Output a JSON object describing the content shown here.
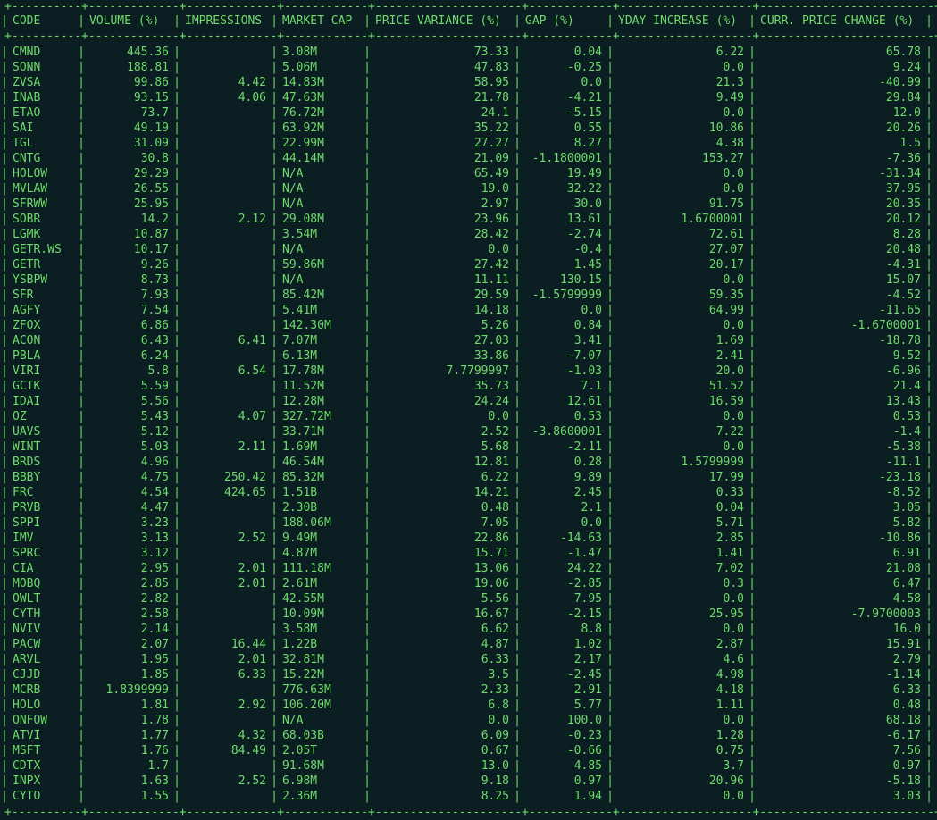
{
  "table": {
    "columns": [
      "CODE",
      "VOLUME (%)",
      "IMPRESSIONS",
      "MARKET CAP",
      "PRICE VARIANCE (%)",
      "GAP (%)",
      "YDAY INCREASE (%)",
      "CURR. PRICE CHANGE (%)"
    ],
    "rows": [
      [
        "CMND",
        "445.36",
        "",
        "3.08M",
        "73.33",
        "0.04",
        "6.22",
        "65.78"
      ],
      [
        "SONN",
        "188.81",
        "",
        "5.06M",
        "47.83",
        "-0.25",
        "0.0",
        "9.24"
      ],
      [
        "ZVSA",
        "99.86",
        "4.42",
        "14.83M",
        "58.95",
        "0.0",
        "21.3",
        "-40.99"
      ],
      [
        "INAB",
        "93.15",
        "4.06",
        "47.63M",
        "21.78",
        "-4.21",
        "9.49",
        "29.84"
      ],
      [
        "ETAO",
        "73.7",
        "",
        "76.72M",
        "24.1",
        "-5.15",
        "0.0",
        "12.0"
      ],
      [
        "SAI",
        "49.19",
        "",
        "63.92M",
        "35.22",
        "0.55",
        "10.86",
        "20.26"
      ],
      [
        "TGL",
        "31.09",
        "",
        "22.99M",
        "27.27",
        "8.27",
        "4.38",
        "1.5"
      ],
      [
        "CNTG",
        "30.8",
        "",
        "44.14M",
        "21.09",
        "-1.1800001",
        "153.27",
        "-7.36"
      ],
      [
        "HOLOW",
        "29.29",
        "",
        "N/A",
        "65.49",
        "19.49",
        "0.0",
        "-31.34"
      ],
      [
        "MVLAW",
        "26.55",
        "",
        "N/A",
        "19.0",
        "32.22",
        "0.0",
        "37.95"
      ],
      [
        "SFRWW",
        "25.95",
        "",
        "N/A",
        "2.97",
        "30.0",
        "91.75",
        "20.35"
      ],
      [
        "SOBR",
        "14.2",
        "2.12",
        "29.08M",
        "23.96",
        "13.61",
        "1.6700001",
        "20.12"
      ],
      [
        "LGMK",
        "10.87",
        "",
        "3.54M",
        "28.42",
        "-2.74",
        "72.61",
        "8.28"
      ],
      [
        "GETR.WS",
        "10.17",
        "",
        "N/A",
        "0.0",
        "-0.4",
        "27.07",
        "20.48"
      ],
      [
        "GETR",
        "9.26",
        "",
        "59.86M",
        "27.42",
        "1.45",
        "20.17",
        "-4.31"
      ],
      [
        "YSBPW",
        "8.73",
        "",
        "N/A",
        "11.11",
        "130.15",
        "0.0",
        "15.07"
      ],
      [
        "SFR",
        "7.93",
        "",
        "85.42M",
        "29.59",
        "-1.5799999",
        "59.35",
        "-4.52"
      ],
      [
        "AGFY",
        "7.54",
        "",
        "5.41M",
        "14.18",
        "0.0",
        "64.99",
        "-11.65"
      ],
      [
        "ZFOX",
        "6.86",
        "",
        "142.30M",
        "5.26",
        "0.84",
        "0.0",
        "-1.6700001"
      ],
      [
        "ACON",
        "6.43",
        "6.41",
        "7.07M",
        "27.03",
        "3.41",
        "1.69",
        "-18.78"
      ],
      [
        "PBLA",
        "6.24",
        "",
        "6.13M",
        "33.86",
        "-7.07",
        "2.41",
        "9.52"
      ],
      [
        "VIRI",
        "5.8",
        "6.54",
        "17.78M",
        "7.7799997",
        "-1.03",
        "20.0",
        "-6.96"
      ],
      [
        "GCTK",
        "5.59",
        "",
        "11.52M",
        "35.73",
        "7.1",
        "51.52",
        "21.4"
      ],
      [
        "IDAI",
        "5.56",
        "",
        "12.28M",
        "24.24",
        "12.61",
        "16.59",
        "13.43"
      ],
      [
        "OZ",
        "5.43",
        "4.07",
        "327.72M",
        "0.0",
        "0.53",
        "0.0",
        "0.53"
      ],
      [
        "UAVS",
        "5.12",
        "",
        "33.71M",
        "2.52",
        "-3.8600001",
        "7.22",
        "-1.4"
      ],
      [
        "WINT",
        "5.03",
        "2.11",
        "1.69M",
        "5.68",
        "-2.11",
        "0.0",
        "-5.38"
      ],
      [
        "BRDS",
        "4.96",
        "",
        "46.54M",
        "12.81",
        "0.28",
        "1.5799999",
        "-11.1"
      ],
      [
        "BBBY",
        "4.75",
        "250.42",
        "85.32M",
        "6.22",
        "9.89",
        "17.99",
        "-23.18"
      ],
      [
        "FRC",
        "4.54",
        "424.65",
        "1.51B",
        "14.21",
        "2.45",
        "0.33",
        "-8.52"
      ],
      [
        "PRVB",
        "4.47",
        "",
        "2.30B",
        "0.48",
        "2.1",
        "0.04",
        "3.05"
      ],
      [
        "SPPI",
        "3.23",
        "",
        "188.06M",
        "7.05",
        "0.0",
        "5.71",
        "-5.82"
      ],
      [
        "IMV",
        "3.13",
        "2.52",
        "9.49M",
        "22.86",
        "-14.63",
        "2.85",
        "-10.86"
      ],
      [
        "SPRC",
        "3.12",
        "",
        "4.87M",
        "15.71",
        "-1.47",
        "1.41",
        "6.91"
      ],
      [
        "CIA",
        "2.95",
        "2.01",
        "111.18M",
        "13.06",
        "24.22",
        "7.02",
        "21.08"
      ],
      [
        "MOBQ",
        "2.85",
        "2.01",
        "2.61M",
        "19.06",
        "-2.85",
        "0.3",
        "6.47"
      ],
      [
        "OWLT",
        "2.82",
        "",
        "42.55M",
        "5.56",
        "7.95",
        "0.0",
        "4.58"
      ],
      [
        "CYTH",
        "2.58",
        "",
        "10.09M",
        "16.67",
        "-2.15",
        "25.95",
        "-7.9700003"
      ],
      [
        "NVIV",
        "2.14",
        "",
        "3.58M",
        "6.62",
        "8.8",
        "0.0",
        "16.0"
      ],
      [
        "PACW",
        "2.07",
        "16.44",
        "1.22B",
        "4.87",
        "1.02",
        "2.87",
        "15.91"
      ],
      [
        "ARVL",
        "1.95",
        "2.01",
        "32.81M",
        "6.33",
        "2.17",
        "4.6",
        "2.79"
      ],
      [
        "CJJD",
        "1.85",
        "6.33",
        "15.22M",
        "3.5",
        "-2.45",
        "4.98",
        "-1.14"
      ],
      [
        "MCRB",
        "1.8399999",
        "",
        "776.63M",
        "2.33",
        "2.91",
        "4.18",
        "6.33"
      ],
      [
        "HOLO",
        "1.81",
        "2.92",
        "106.20M",
        "6.8",
        "5.77",
        "1.11",
        "0.48"
      ],
      [
        "ONFOW",
        "1.78",
        "",
        "N/A",
        "0.0",
        "100.0",
        "0.0",
        "68.18"
      ],
      [
        "ATVI",
        "1.77",
        "4.32",
        "68.03B",
        "6.09",
        "-0.23",
        "1.28",
        "-6.17"
      ],
      [
        "MSFT",
        "1.76",
        "84.49",
        "2.05T",
        "0.67",
        "-0.66",
        "0.75",
        "7.56"
      ],
      [
        "CDTX",
        "1.7",
        "",
        "91.68M",
        "13.0",
        "4.85",
        "3.7",
        "-0.97"
      ],
      [
        "INPX",
        "1.63",
        "2.52",
        "6.98M",
        "9.18",
        "0.97",
        "20.96",
        "-5.18"
      ],
      [
        "CYTO",
        "1.55",
        "",
        "2.36M",
        "8.25",
        "1.94",
        "0.0",
        "3.03"
      ]
    ]
  }
}
